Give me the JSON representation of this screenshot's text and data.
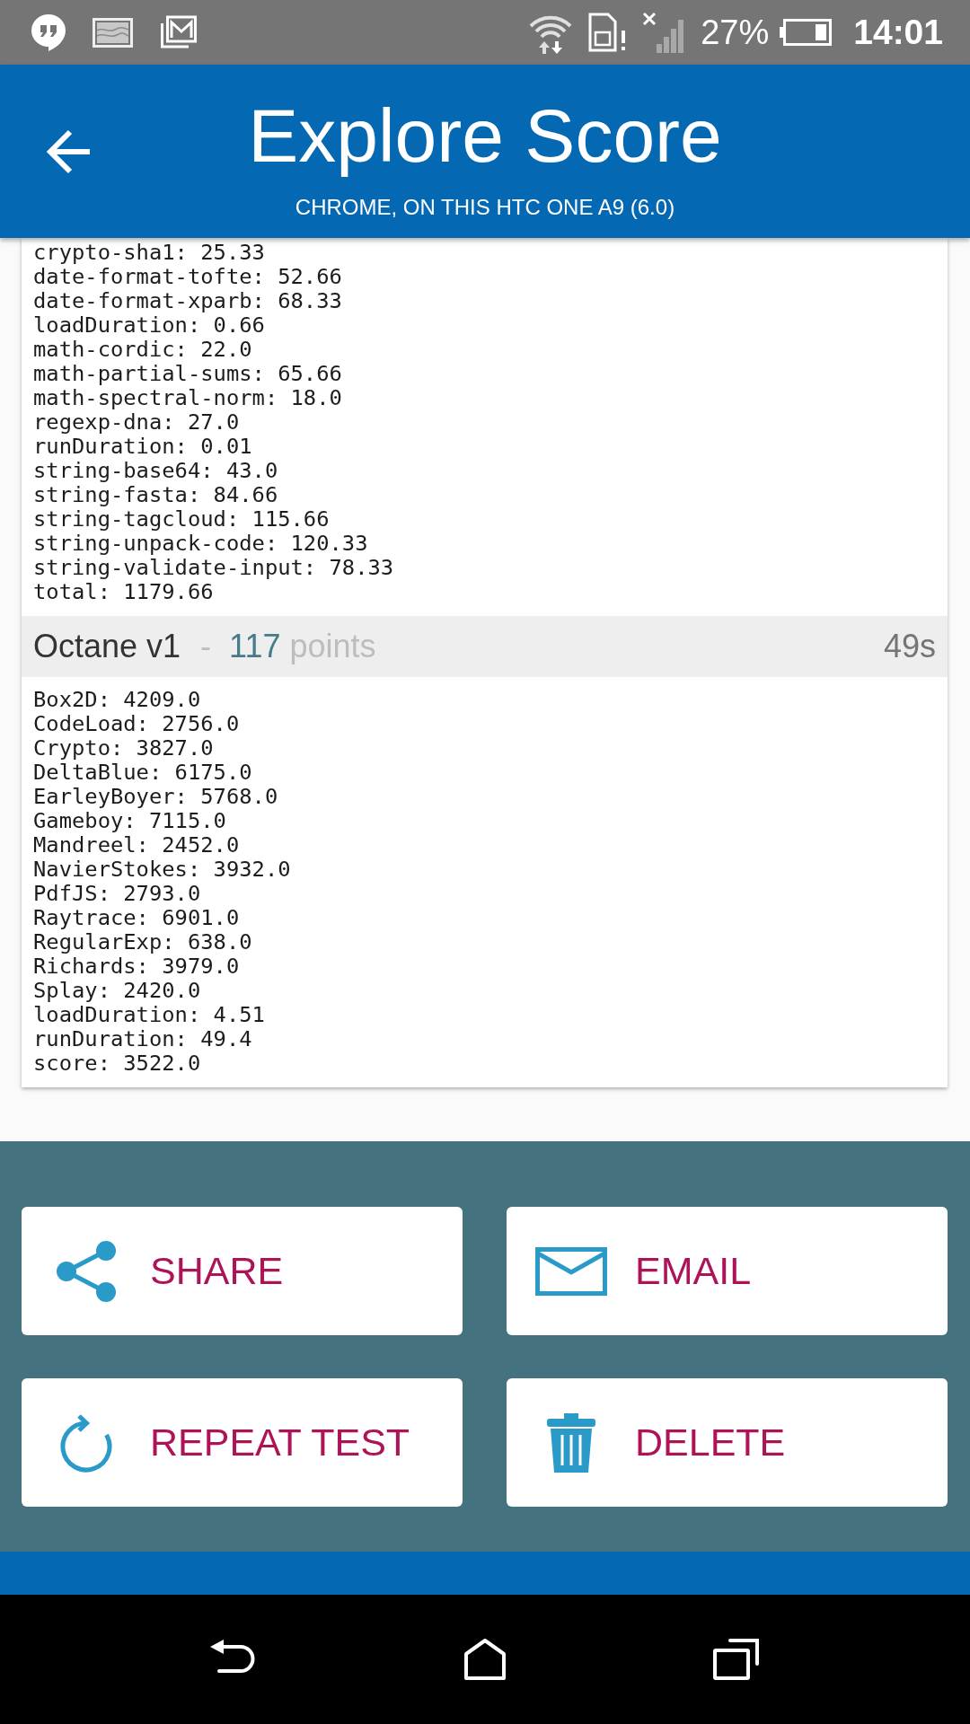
{
  "status_bar": {
    "battery": "27%",
    "time": "14:01"
  },
  "app_bar": {
    "title": "Explore Score",
    "subtitle": "CHROME, ON THIS HTC ONE A9 (6.0)"
  },
  "sections": [
    {
      "lines": [
        "crypto-sha1: 25.33",
        "date-format-tofte: 52.66",
        "date-format-xparb: 68.33",
        "loadDuration: 0.66",
        "math-cordic: 22.0",
        "math-partial-sums: 65.66",
        "math-spectral-norm: 18.0",
        "regexp-dna: 27.0",
        "runDuration: 0.01",
        "string-base64: 43.0",
        "string-fasta: 84.66",
        "string-tagcloud: 115.66",
        "string-unpack-code: 120.33",
        "string-validate-input: 78.33",
        "total: 1179.66"
      ]
    },
    {
      "header": {
        "name": "Octane v1",
        "separator": "-",
        "score": "117",
        "unit": "points",
        "duration": "49s"
      },
      "lines": [
        "Box2D: 4209.0",
        "CodeLoad: 2756.0",
        "Crypto: 3827.0",
        "DeltaBlue: 6175.0",
        "EarleyBoyer: 5768.0",
        "Gameboy: 7115.0",
        "Mandreel: 2452.0",
        "NavierStokes: 3932.0",
        "PdfJS: 2793.0",
        "Raytrace: 6901.0",
        "RegularExp: 638.0",
        "Richards: 3979.0",
        "Splay: 2420.0",
        "loadDuration: 4.51",
        "runDuration: 49.4",
        "score: 3522.0"
      ]
    }
  ],
  "actions": [
    {
      "kind": "share",
      "label": "SHARE"
    },
    {
      "kind": "email",
      "label": "EMAIL"
    },
    {
      "kind": "repeat",
      "label": "REPEAT TEST"
    },
    {
      "kind": "delete",
      "label": "DELETE"
    }
  ]
}
